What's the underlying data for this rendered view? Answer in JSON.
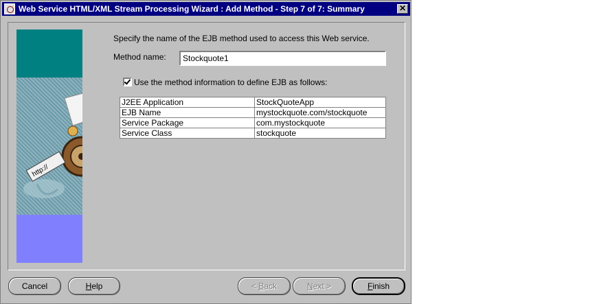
{
  "window": {
    "title": "Web Service HTML/XML Stream Processing Wizard : Add Method - Step 7 of 7: Summary",
    "close_glyph": "✕"
  },
  "form": {
    "instruction": "Specify the name of the EJB method used to access this Web service.",
    "method_label": "Method name:",
    "method_value": "Stockquote1",
    "checkbox_label": "Use the method information to define EJB as follows:",
    "checkbox_checked": true
  },
  "ejb_table": {
    "rows": [
      {
        "key": "J2EE Application",
        "value": "StockQuoteApp"
      },
      {
        "key": "EJB Name",
        "value": "mystockquote.com/stockquote"
      },
      {
        "key": "Service Package",
        "value": "com.mystockquote"
      },
      {
        "key": "Service Class",
        "value": "stockquote"
      }
    ]
  },
  "banner": {
    "tag_text": "http://"
  },
  "buttons": {
    "cancel": "Cancel",
    "help_rest": "elp",
    "help_mnemonic": "H",
    "back_arrow": "<",
    "back_mnemonic": "B",
    "back_rest": "ack",
    "next_mnemonic": "N",
    "next_rest": "ext",
    "next_arrow": ">",
    "finish_mnemonic": "F",
    "finish_rest": "inish"
  }
}
